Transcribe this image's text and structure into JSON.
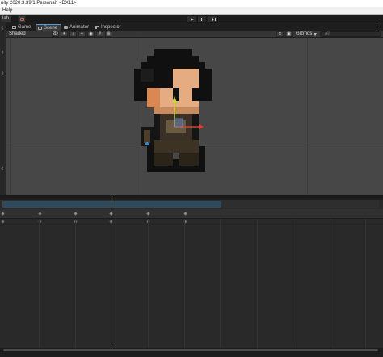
{
  "window": {
    "title": "nity 2020.3.39f1 Personal* <DX11>",
    "menu_help": "Help"
  },
  "toolbar": {
    "collab_label": "lab",
    "play_icon": "play-icon",
    "pause_icon": "pause-icon",
    "step_icon": "step-icon"
  },
  "tabs": [
    {
      "label": "Game",
      "icon": "game-icon"
    },
    {
      "label": "Scene",
      "icon": "scene-icon"
    },
    {
      "label": "Animator",
      "icon": "animator-icon"
    },
    {
      "label": "Inspector",
      "icon": "inspector-icon"
    }
  ],
  "scene_toolbar": {
    "shading_mode": "Shaded",
    "mode_2d": "2D",
    "gizmos_label": "Gizmos",
    "search_placeholder": "All"
  },
  "colors": {
    "scene_background": "#474747",
    "active_tab_accent": "#4aa0e0",
    "timeline_range": "#2f4a5c",
    "gizmo_y_axis": "#c9d92a",
    "gizmo_x_axis": "#e0402a"
  }
}
